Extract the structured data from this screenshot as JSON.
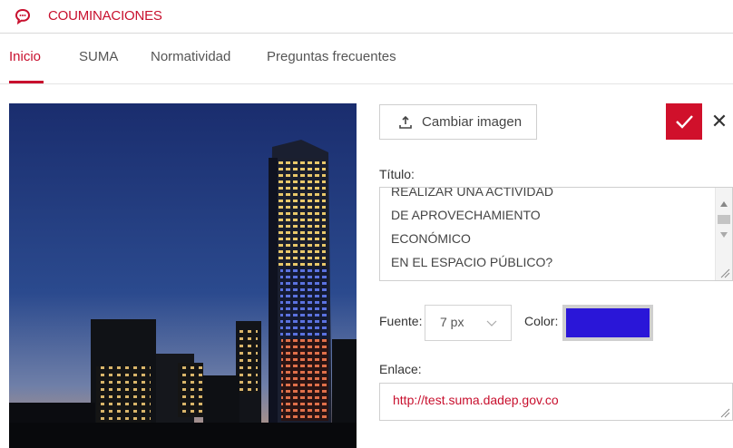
{
  "header": {
    "brand_title": "COUMINACIONES",
    "brand_icon": "speech-bubble-icon",
    "accent_color": "#c8102e"
  },
  "tabs": [
    {
      "label": "Inicio",
      "active": true
    },
    {
      "label": "SUMA",
      "active": false
    },
    {
      "label": "Normatividad",
      "active": false
    },
    {
      "label": "Preguntas frecuentes",
      "active": false
    }
  ],
  "editor": {
    "upload_label": "Cambiar imagen",
    "upload_icon": "upload-icon",
    "confirm_icon": "checkmark-icon",
    "cancel_icon": "close-icon",
    "title_label": "Título:",
    "title_lines": [
      "REALIZAR UNA ACTIVIDAD",
      "DE APROVECHAMIENTO",
      "ECONÓMICO",
      "EN EL ESPACIO PÚBLICO?"
    ],
    "font_label": "Fuente:",
    "font_value": "7 px",
    "color_label": "Color:",
    "color_value": "#2a16d8",
    "link_label": "Enlace:",
    "link_value": "http://test.suma.dadep.gov.co"
  }
}
